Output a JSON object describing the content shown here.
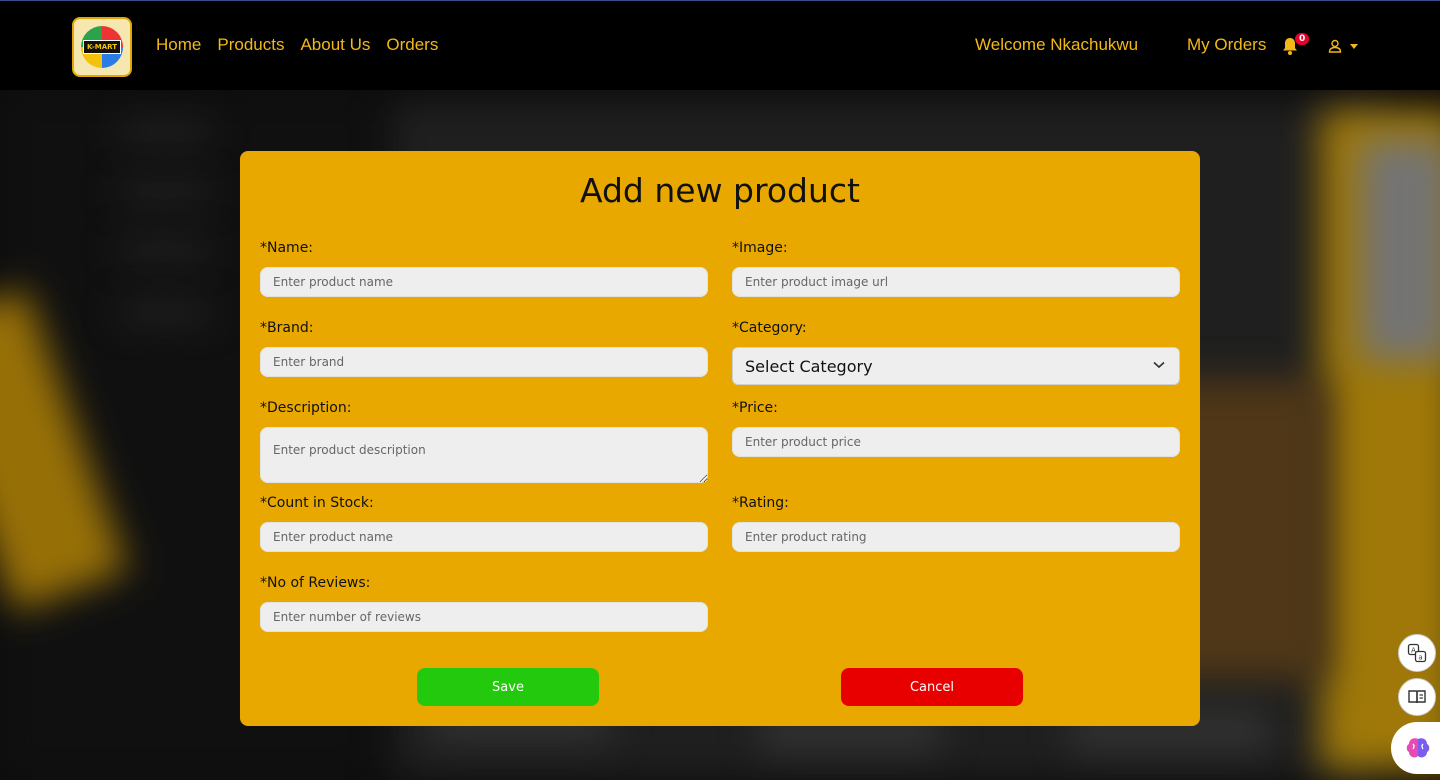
{
  "header": {
    "logo_text": "K-MART",
    "nav": [
      "Home",
      "Products",
      "About Us",
      "Orders"
    ],
    "welcome": "Welcome Nkachukwu",
    "my_orders": "My Orders",
    "notification_count": "0",
    "colors": {
      "bar": "#000000",
      "link": "#f3b818",
      "badge": "#e8002a"
    }
  },
  "modal": {
    "title": "Add new product",
    "fields": {
      "name": {
        "label": "*Name:",
        "placeholder": "Enter product name"
      },
      "image": {
        "label": "*Image:",
        "placeholder": "Enter product image url"
      },
      "brand": {
        "label": "*Brand:",
        "placeholder": "Enter brand"
      },
      "category": {
        "label": "*Category:",
        "selected": "Select Category"
      },
      "description": {
        "label": "*Description:",
        "placeholder": "Enter product description"
      },
      "price": {
        "label": "*Price:",
        "placeholder": "Enter product price"
      },
      "count_in_stock": {
        "label": "*Count in Stock:",
        "placeholder": "Enter product name"
      },
      "rating": {
        "label": "*Rating:",
        "placeholder": "Enter product rating"
      },
      "num_reviews": {
        "label": "*No of Reviews:",
        "placeholder": "Enter number of reviews"
      }
    },
    "save_label": "Save",
    "cancel_label": "Cancel",
    "colors": {
      "background": "#e8a800",
      "save": "#22c90c",
      "cancel": "#e80000"
    }
  },
  "side_tools": [
    "translate-icon",
    "reader-icon",
    "brain-icon"
  ]
}
